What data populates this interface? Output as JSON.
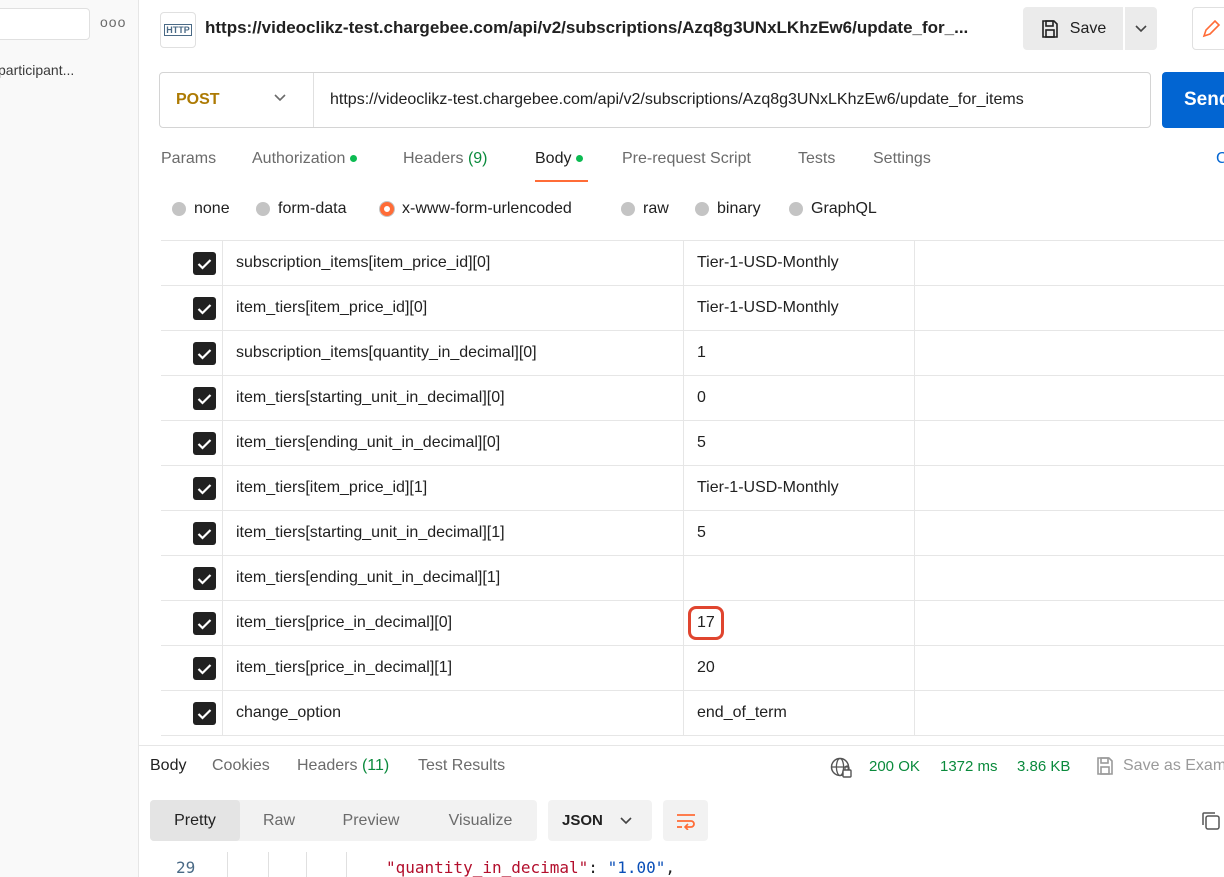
{
  "sidebar": {
    "more_label": "ooo",
    "item_label": "participant..."
  },
  "header": {
    "http_badge": "HTTP",
    "title": "https://videoclikz-test.chargebee.com/api/v2/subscriptions/Azq8g3UNxLKhzEw6/update_for_...",
    "save_label": "Save"
  },
  "request": {
    "method": "POST",
    "url": "https://videoclikz-test.chargebee.com/api/v2/subscriptions/Azq8g3UNxLKhzEw6/update_for_items",
    "send_label": "Send"
  },
  "tabs": {
    "params": "Params",
    "authorization": "Authorization",
    "headers": "Headers",
    "headers_count": "(9)",
    "body": "Body",
    "prerequest": "Pre-request Script",
    "tests": "Tests",
    "settings": "Settings",
    "cookies_link": "Cookies"
  },
  "body_types": [
    "none",
    "form-data",
    "x-www-form-urlencoded",
    "raw",
    "binary",
    "GraphQL"
  ],
  "params": [
    {
      "key": "subscription_items[item_price_id][0]",
      "value": "Tier-1-USD-Monthly"
    },
    {
      "key": "item_tiers[item_price_id][0]",
      "value": "Tier-1-USD-Monthly"
    },
    {
      "key": "subscription_items[quantity_in_decimal][0]",
      "value": "1"
    },
    {
      "key": "item_tiers[starting_unit_in_decimal][0]",
      "value": "0"
    },
    {
      "key": "item_tiers[ending_unit_in_decimal][0]",
      "value": "5"
    },
    {
      "key": "item_tiers[item_price_id][1]",
      "value": "Tier-1-USD-Monthly"
    },
    {
      "key": "item_tiers[starting_unit_in_decimal][1]",
      "value": "5"
    },
    {
      "key": "item_tiers[ending_unit_in_decimal][1]",
      "value": ""
    },
    {
      "key": "item_tiers[price_in_decimal][0]",
      "value": "17"
    },
    {
      "key": "item_tiers[price_in_decimal][1]",
      "value": "20"
    },
    {
      "key": "change_option",
      "value": "end_of_term"
    }
  ],
  "response": {
    "tabs": {
      "body": "Body",
      "cookies": "Cookies",
      "headers": "Headers",
      "headers_count": "(11)",
      "test_results": "Test Results"
    },
    "status": "200 OK",
    "time": "1372 ms",
    "size": "3.86 KB",
    "save_example": "Save as Example",
    "views": [
      "Pretty",
      "Raw",
      "Preview",
      "Visualize"
    ],
    "format": "JSON",
    "code": {
      "line_no": "29",
      "key": "\"quantity_in_decimal\"",
      "sep": ": ",
      "value": "\"1.00\"",
      "tail": ","
    }
  },
  "colors": {
    "accent": "#ff6c37",
    "send": "#0265d2",
    "method": "#ad7a03",
    "success": "#0a8a3c",
    "highlight": "#e0452f"
  }
}
